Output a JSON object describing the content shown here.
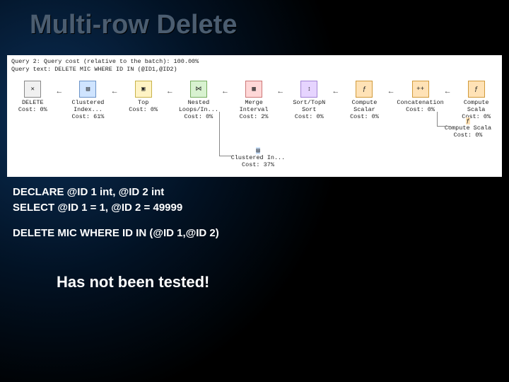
{
  "title": "Multi-row Delete",
  "plan_header": {
    "line1": "Query 2: Query cost (relative to the batch): 100.00%",
    "line2": "Query text: DELETE MIC WHERE ID IN (@ID1,@ID2)"
  },
  "nodes": [
    {
      "label": "DELETE",
      "cost": "Cost: 0%",
      "icon": "delete"
    },
    {
      "label": "Clustered Index...",
      "cost": "Cost: 61%",
      "icon": "table"
    },
    {
      "label": "Top",
      "cost": "Cost: 0%",
      "icon": "top"
    },
    {
      "label": "Nested Loops/In...",
      "cost": "Cost: 0%",
      "icon": "nested"
    },
    {
      "label": "Merge Interval",
      "cost": "Cost: 2%",
      "icon": "merge"
    },
    {
      "label": "Sort/TopN Sort",
      "cost": "Cost: 0%",
      "icon": "sort"
    },
    {
      "label": "Compute Scalar",
      "cost": "Cost: 0%",
      "icon": "scalar"
    },
    {
      "label": "Concatenation",
      "cost": "Cost: 0%",
      "icon": "scalar"
    },
    {
      "label": "Compute Scala",
      "cost": "Cost: 0%",
      "icon": "scalar"
    }
  ],
  "wrap_node": {
    "label": "Compute Scala",
    "cost": "Cost: 0%",
    "icon": "scalar"
  },
  "bottom_node": {
    "label": "Clustered In...",
    "cost": "Cost: 37%",
    "icon": "table"
  },
  "sql": {
    "line1": "DECLARE @ID 1 int, @ID 2 int",
    "line2": "SELECT @ID 1 = 1, @ID 2 = 49999",
    "line3": "DELETE MIC WHERE ID IN (@ID 1,@ID 2)"
  },
  "warning": "Has not been tested!"
}
